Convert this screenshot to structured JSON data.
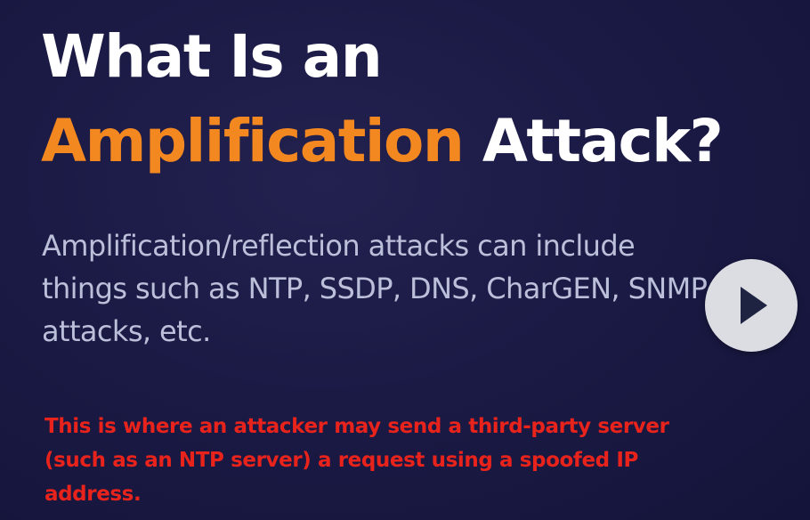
{
  "slide": {
    "title": {
      "line1": "What Is an",
      "accent": "Amplification",
      "line2_end": " Attack?"
    },
    "subtitle": "Amplification/reflection attacks can include things such as NTP, SSDP, DNS, CharGEN, SNMP attacks, etc.",
    "highlight": "This is where an attacker may send a third-party server (such as an NTP server) a request using a spoofed IP address."
  },
  "player": {
    "play_icon": "play-icon"
  },
  "colors": {
    "background": "#1b1a45",
    "title": "#ffffff",
    "accent": "#f48820",
    "subtitle": "#bcbfd9",
    "highlight": "#e8231c",
    "play_button": "#dcdde2"
  }
}
